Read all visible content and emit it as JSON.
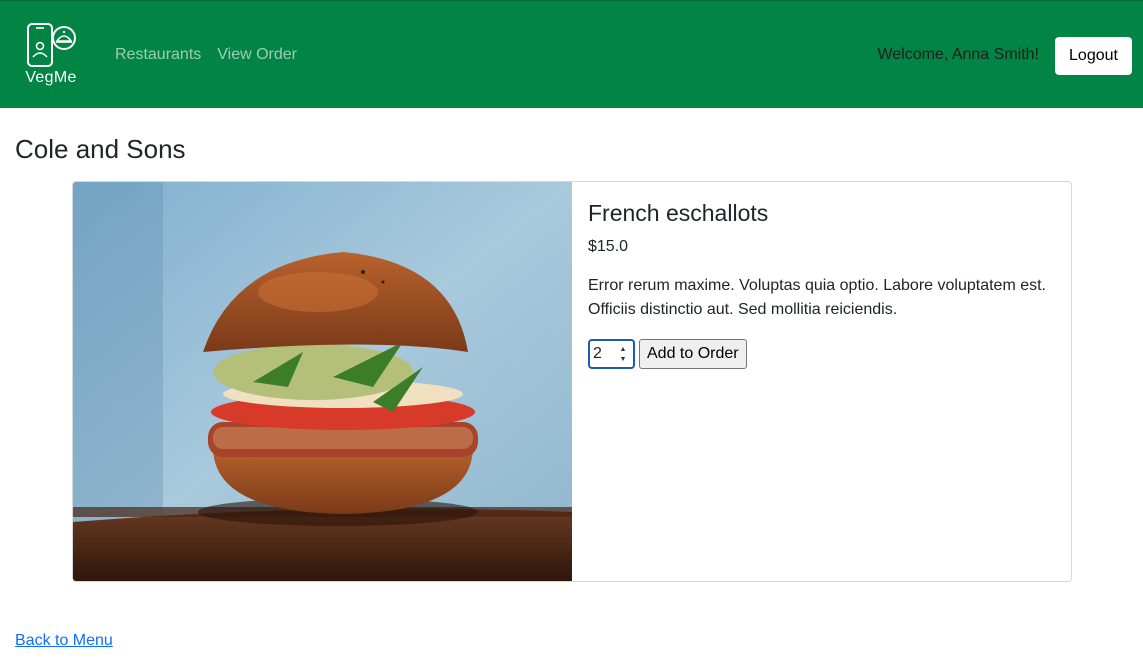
{
  "navbar": {
    "brand_name": "VegMe",
    "links": [
      "Restaurants",
      "View Order"
    ],
    "welcome_text": "Welcome, Anna Smith!",
    "logout_label": "Logout",
    "background_color": "#018444"
  },
  "restaurant": {
    "name": "Cole and Sons"
  },
  "menu_item": {
    "name": "French eschallots",
    "price": "$15.0",
    "description": "Error rerum maxime. Voluptas quia optio. Labore voluptatem est. Officiis distinctio aut. Sed mollitia reiciendis.",
    "quantity": "2",
    "add_label": "Add to Order",
    "image_icon": "veggie-burger-photo"
  },
  "footer": {
    "back_label": "Back to Menu"
  }
}
